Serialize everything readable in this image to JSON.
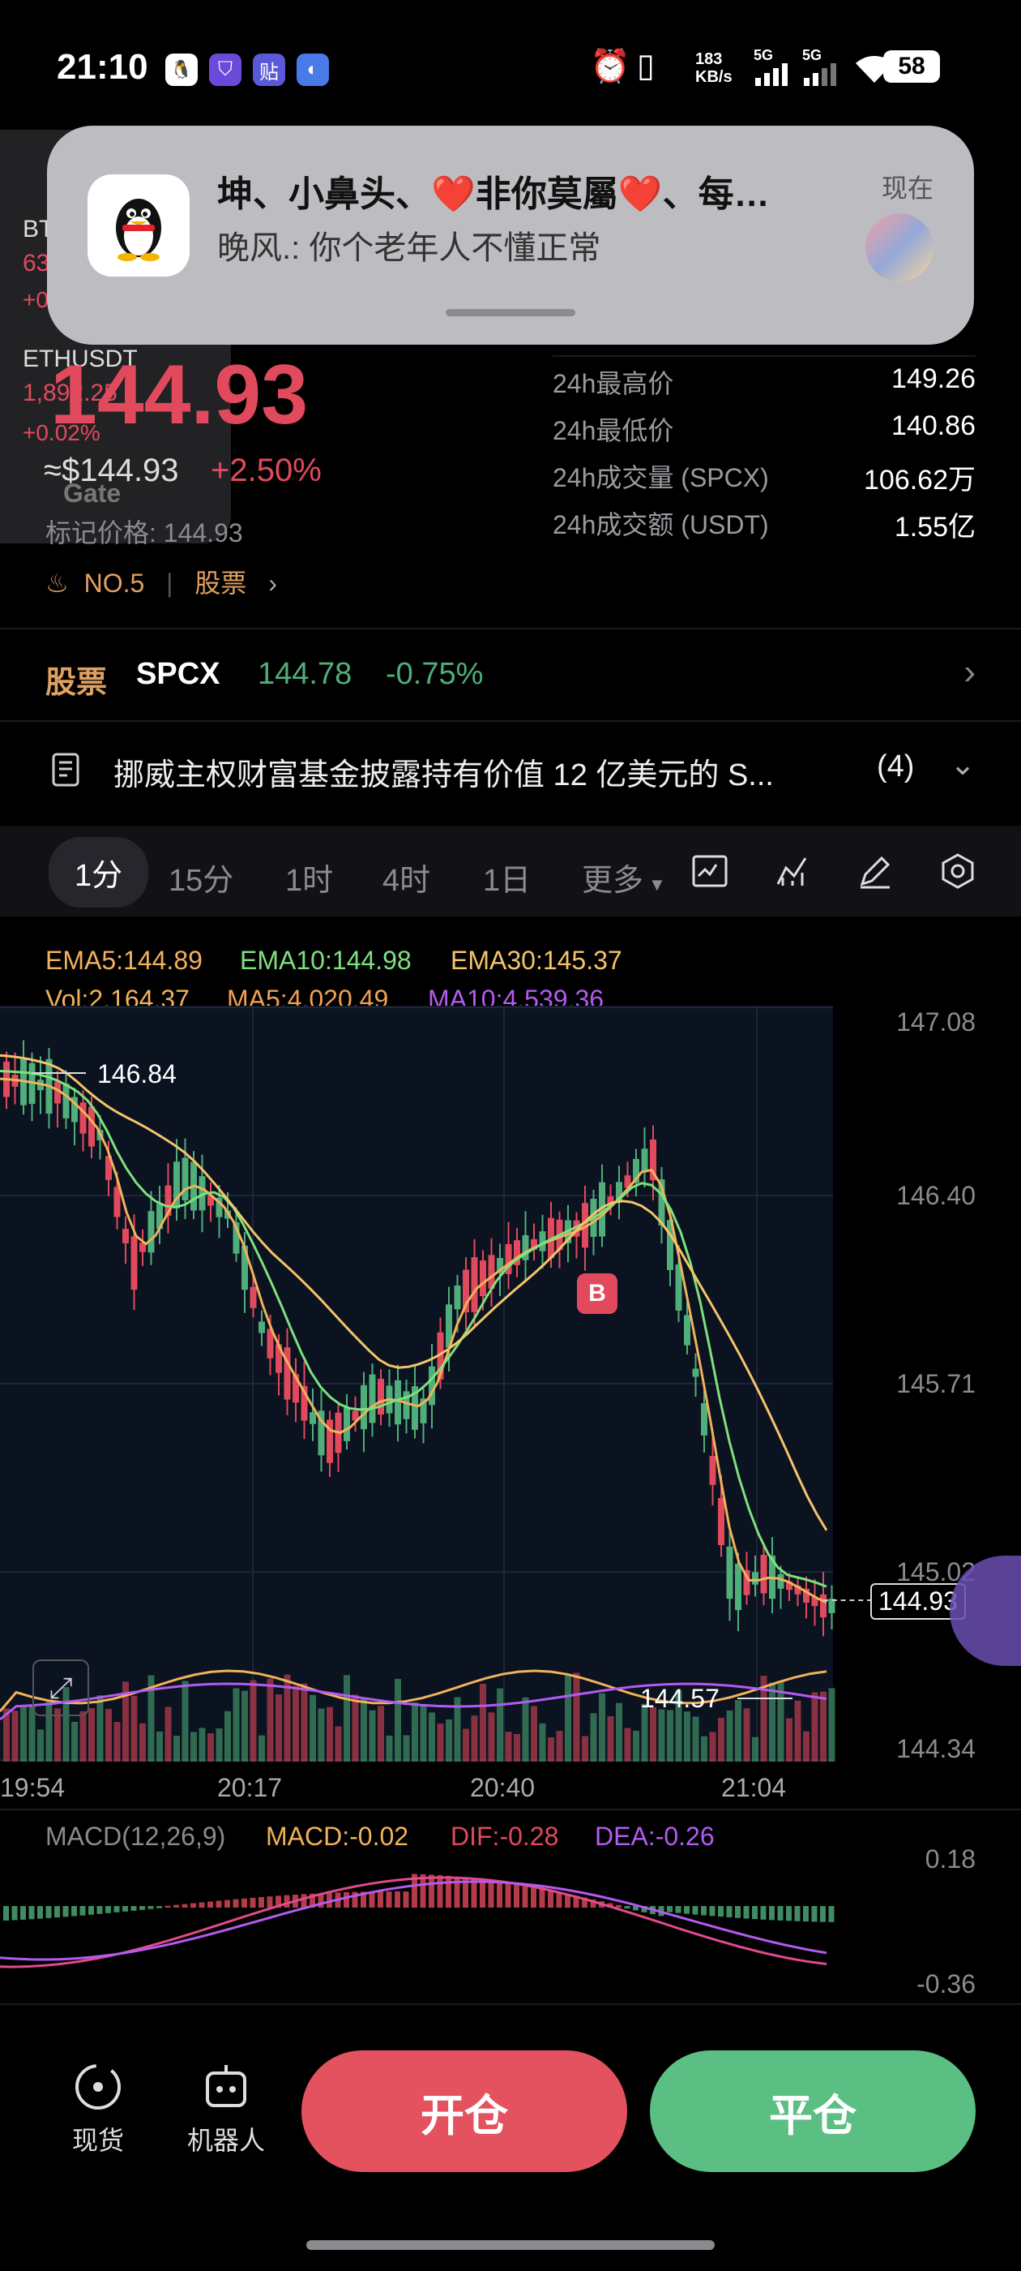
{
  "status": {
    "time": "21:10",
    "net_speed": "183\nKB/s",
    "net1": "5G",
    "net2": "5G",
    "battery": "58"
  },
  "widget": {
    "btc_label": "BT",
    "btc_price": "63",
    "btc_pct": "+0",
    "eth_label": "ETHUSDT",
    "eth_price": "1,892.25",
    "eth_pct": "+0.02%",
    "brand": "Gate"
  },
  "notification": {
    "title": "坤、小鼻头、❤️非你莫屬❤️、每…",
    "body": "晚风.: 你个老年人不懂正常",
    "time": "现在"
  },
  "price": {
    "last": "144.93",
    "usd": "≈$144.93",
    "change_pct": "+2.50%",
    "mark_price": "标记价格: 144.93",
    "rank": "NO.5",
    "category": "股票"
  },
  "stats": [
    {
      "label": "24h最高价",
      "value": "149.26"
    },
    {
      "label": "24h最低价",
      "value": "140.86"
    },
    {
      "label": "24h成交量 (SPCX)",
      "value": "106.62万"
    },
    {
      "label": "24h成交额 (USDT)",
      "value": "1.55亿"
    }
  ],
  "ticker": {
    "tag": "股票",
    "symbol": "SPCX",
    "price": "144.78",
    "change": "-0.75%"
  },
  "news": {
    "text": "挪威主权财富基金披露持有价值 12 亿美元的 S...",
    "count": "(4)"
  },
  "tabs": [
    "1分",
    "15分",
    "1时",
    "4时",
    "1日",
    "更多"
  ],
  "indicators": {
    "ema5": "EMA5:144.89",
    "ema10": "EMA10:144.98",
    "ema30": "EMA30:145.37",
    "vol": "Vol:2,164.37",
    "ma5": "MA5:4,020.49",
    "ma10": "MA10:4,539.36"
  },
  "chart": {
    "y_ticks": [
      "147.08",
      "146.40",
      "145.71",
      "145.02",
      "144.34"
    ],
    "x_ticks": [
      "19:54",
      "20:17",
      "20:40",
      "21:04"
    ],
    "high_label": "146.84",
    "low_label": "144.57",
    "current_label": "144.93",
    "buy_marker": "B",
    "colors": {
      "up": "#e14a5c",
      "down": "#4fae7a",
      "ema5": "#f1b25a",
      "ema10": "#7fe07f",
      "ema30": "#f5c46a",
      "ma10": "#b35bf0"
    }
  },
  "macd": {
    "title": "MACD(12,26,9)",
    "macd": "MACD:-0.02",
    "dif": "DIF:-0.28",
    "dea": "DEA:-0.26",
    "y_top": "0.18",
    "y_bottom": "-0.36"
  },
  "bottom": {
    "spot": "现货",
    "robot": "机器人",
    "open": "开仓",
    "close": "平仓"
  },
  "chart_data": {
    "type": "line",
    "title": "",
    "x": [
      "19:54",
      "20:17",
      "20:40",
      "21:04"
    ],
    "ylim": [
      144.34,
      147.08
    ],
    "series": [
      {
        "name": "EMA5",
        "values": [
          146.7,
          146.35,
          145.95,
          146.55,
          144.89
        ]
      },
      {
        "name": "EMA10",
        "values": [
          146.75,
          146.45,
          145.85,
          146.45,
          144.98
        ]
      },
      {
        "name": "EMA30",
        "values": [
          146.8,
          146.5,
          145.75,
          146.35,
          145.37
        ]
      }
    ]
  }
}
